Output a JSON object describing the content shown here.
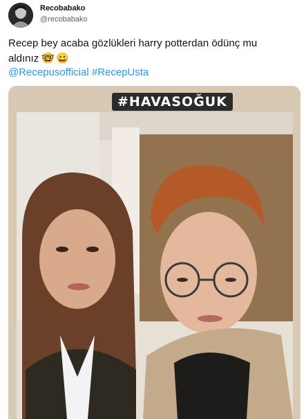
{
  "tweet": {
    "display_name": "Recobabako",
    "handle": "@recobabako",
    "text_line1": "Recep bey acaba gözlükleri harry potterdan ödünç mu",
    "text_line2": "aldınız",
    "emojis": "🤓😀",
    "mentions": [
      "@Recepusofficial",
      "#RecepUsta"
    ]
  },
  "media": {
    "sticker_text": "#HAVASOĞUK",
    "description_colors": {
      "link": "#1d9bf0",
      "sticker_bg": "#2b2b2b"
    }
  }
}
